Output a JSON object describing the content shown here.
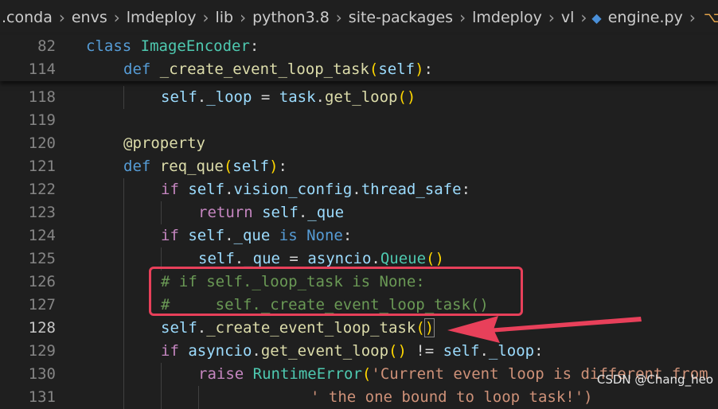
{
  "breadcrumb": {
    "items": [
      ".conda",
      "envs",
      "lmdeploy",
      "lib",
      "python3.8",
      "site-packages",
      "lmdeploy",
      "vl",
      "engine.py"
    ],
    "trailing": "I"
  },
  "sticky": [
    {
      "ln": "82",
      "tokens": [
        [
          "kw",
          "class "
        ],
        [
          "cls",
          "ImageEncoder"
        ],
        [
          "pun",
          ":"
        ]
      ],
      "indent": 0
    },
    {
      "ln": "114",
      "tokens": [
        [
          "kw",
          "def "
        ],
        [
          "fn",
          "_create_event_loop_task"
        ],
        [
          "br1",
          "("
        ],
        [
          "slf",
          "self"
        ],
        [
          "br1",
          ")"
        ],
        [
          "pun",
          ":"
        ]
      ],
      "indent": 1
    }
  ],
  "lines": [
    {
      "ln": "118",
      "indent": 2,
      "tokens": [
        [
          "slf",
          "self"
        ],
        [
          "pun",
          "."
        ],
        [
          "var",
          "_loop"
        ],
        [
          "pun",
          " = "
        ],
        [
          "var",
          "task"
        ],
        [
          "pun",
          "."
        ],
        [
          "fn",
          "get_loop"
        ],
        [
          "br1",
          "()"
        ]
      ]
    },
    {
      "ln": "119",
      "indent": 0,
      "tokens": []
    },
    {
      "ln": "120",
      "indent": 1,
      "tokens": [
        [
          "fn",
          "@property"
        ]
      ]
    },
    {
      "ln": "121",
      "indent": 1,
      "tokens": [
        [
          "kw",
          "def "
        ],
        [
          "fn",
          "req_que"
        ],
        [
          "br1",
          "("
        ],
        [
          "slf",
          "self"
        ],
        [
          "br1",
          ")"
        ],
        [
          "pun",
          ":"
        ]
      ]
    },
    {
      "ln": "122",
      "indent": 2,
      "tokens": [
        [
          "ctl",
          "if "
        ],
        [
          "slf",
          "self"
        ],
        [
          "pun",
          "."
        ],
        [
          "var",
          "vision_config"
        ],
        [
          "pun",
          "."
        ],
        [
          "var",
          "thread_safe"
        ],
        [
          "pun",
          ":"
        ]
      ]
    },
    {
      "ln": "123",
      "indent": 3,
      "tokens": [
        [
          "ctl",
          "return "
        ],
        [
          "slf",
          "self"
        ],
        [
          "pun",
          "."
        ],
        [
          "var",
          "_que"
        ]
      ]
    },
    {
      "ln": "124",
      "indent": 2,
      "tokens": [
        [
          "ctl",
          "if "
        ],
        [
          "slf",
          "self"
        ],
        [
          "pun",
          "."
        ],
        [
          "var",
          "_que"
        ],
        [
          "kw",
          " is "
        ],
        [
          "kw",
          "None"
        ],
        [
          "pun",
          ":"
        ]
      ]
    },
    {
      "ln": "125",
      "indent": 3,
      "tokens": [
        [
          "slf",
          "self"
        ],
        [
          "pun",
          "."
        ],
        [
          "var",
          "_que"
        ],
        [
          "pun",
          " = "
        ],
        [
          "var",
          "asyncio"
        ],
        [
          "pun",
          "."
        ],
        [
          "cls",
          "Queue"
        ],
        [
          "br1",
          "()"
        ]
      ]
    },
    {
      "ln": "126",
      "indent": 2,
      "tokens": [
        [
          "cmt",
          "# if self._loop_task is None:"
        ]
      ]
    },
    {
      "ln": "127",
      "indent": 2,
      "tokens": [
        [
          "cmt",
          "#     self._create_event_loop_task()"
        ]
      ]
    },
    {
      "ln": "128",
      "indent": 2,
      "active": true,
      "tokens": [
        [
          "slf",
          "self"
        ],
        [
          "pun",
          "."
        ],
        [
          "fn",
          "_create_event_loop_task"
        ],
        [
          "br1m",
          "()"
        ]
      ]
    },
    {
      "ln": "129",
      "indent": 2,
      "tokens": [
        [
          "ctl",
          "if "
        ],
        [
          "var",
          "asyncio"
        ],
        [
          "pun",
          "."
        ],
        [
          "fn",
          "get_event_loop"
        ],
        [
          "br1",
          "()"
        ],
        [
          "pun",
          " != "
        ],
        [
          "slf",
          "self"
        ],
        [
          "pun",
          "."
        ],
        [
          "var",
          "_loop"
        ],
        [
          "pun",
          ":"
        ]
      ]
    },
    {
      "ln": "130",
      "indent": 3,
      "tokens": [
        [
          "ctl",
          "raise "
        ],
        [
          "cls",
          "RuntimeError"
        ],
        [
          "br1",
          "("
        ],
        [
          "str",
          "'Current event loop is different from"
        ]
      ]
    },
    {
      "ln": "131",
      "indent": 6,
      "tokens": [
        [
          "str",
          "' the one bound to loop task!')"
        ]
      ]
    }
  ],
  "watermark": "CSDN @Chang_heo",
  "colors": {
    "annotation": "#e8405a",
    "background": "#1f1f1f"
  }
}
